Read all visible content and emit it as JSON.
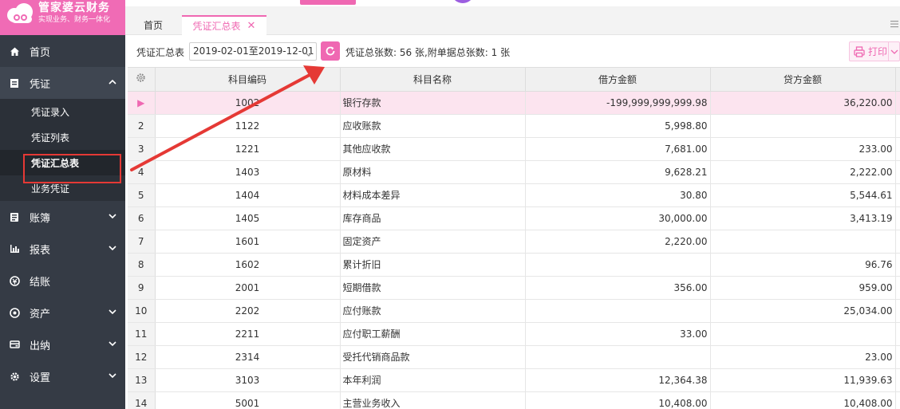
{
  "colors": {
    "accent": "#ef68b2",
    "sidebar": "#353b45",
    "annotation": "#e53935"
  },
  "logo": {
    "title": "管家婆云财务",
    "subtitle": "实现业务、财务一体化"
  },
  "sidebar": {
    "items": [
      {
        "label": "首页",
        "icon": "home-icon"
      },
      {
        "label": "凭证",
        "icon": "voucher-icon",
        "open": true,
        "children": [
          "凭证录入",
          "凭证列表",
          "凭证汇总表",
          "业务凭证"
        ]
      },
      {
        "label": "账簿",
        "icon": "book-icon"
      },
      {
        "label": "报表",
        "icon": "chart-icon"
      },
      {
        "label": "结账",
        "icon": "settle-icon"
      },
      {
        "label": "资产",
        "icon": "asset-icon"
      },
      {
        "label": "出纳",
        "icon": "cashier-icon"
      },
      {
        "label": "设置",
        "icon": "gear-icon"
      }
    ]
  },
  "tabs": {
    "home": "首页",
    "active": "凭证汇总表"
  },
  "toolbar": {
    "label": "凭证汇总表",
    "date_range": "2019-02-01至2019-12-01",
    "summary": "凭证总张数: 56 张,附单据总张数: 1 张",
    "print": "打印"
  },
  "table": {
    "headers": [
      "科目编码",
      "科目名称",
      "借方金额",
      "贷方金额"
    ],
    "rows": [
      {
        "idx": "▶",
        "code": "1002",
        "name": "银行存款",
        "debit": "-199,999,999,999.98",
        "credit": "36,220.00"
      },
      {
        "idx": "2",
        "code": "1122",
        "name": "应收账款",
        "debit": "5,998.80",
        "credit": ""
      },
      {
        "idx": "3",
        "code": "1221",
        "name": "其他应收款",
        "debit": "7,681.00",
        "credit": "233.00"
      },
      {
        "idx": "4",
        "code": "1403",
        "name": "原材料",
        "debit": "9,628.21",
        "credit": "2,222.00"
      },
      {
        "idx": "5",
        "code": "1404",
        "name": "材料成本差异",
        "debit": "30.80",
        "credit": "5,544.61"
      },
      {
        "idx": "6",
        "code": "1405",
        "name": "库存商品",
        "debit": "30,000.00",
        "credit": "3,413.19"
      },
      {
        "idx": "7",
        "code": "1601",
        "name": "固定资产",
        "debit": "2,220.00",
        "credit": ""
      },
      {
        "idx": "8",
        "code": "1602",
        "name": "累计折旧",
        "debit": "",
        "credit": "96.76"
      },
      {
        "idx": "9",
        "code": "2001",
        "name": "短期借款",
        "debit": "356.00",
        "credit": "959.00"
      },
      {
        "idx": "10",
        "code": "2202",
        "name": "应付账款",
        "debit": "",
        "credit": "25,034.00"
      },
      {
        "idx": "11",
        "code": "2211",
        "name": "应付职工薪酬",
        "debit": "33.00",
        "credit": ""
      },
      {
        "idx": "12",
        "code": "2314",
        "name": "受托代销商品款",
        "debit": "",
        "credit": "23.00"
      },
      {
        "idx": "13",
        "code": "3103",
        "name": "本年利润",
        "debit": "12,364.38",
        "credit": "11,939.63"
      },
      {
        "idx": "14",
        "code": "5001",
        "name": "主营业务收入",
        "debit": "10,408.00",
        "credit": "10,408.00"
      }
    ]
  }
}
